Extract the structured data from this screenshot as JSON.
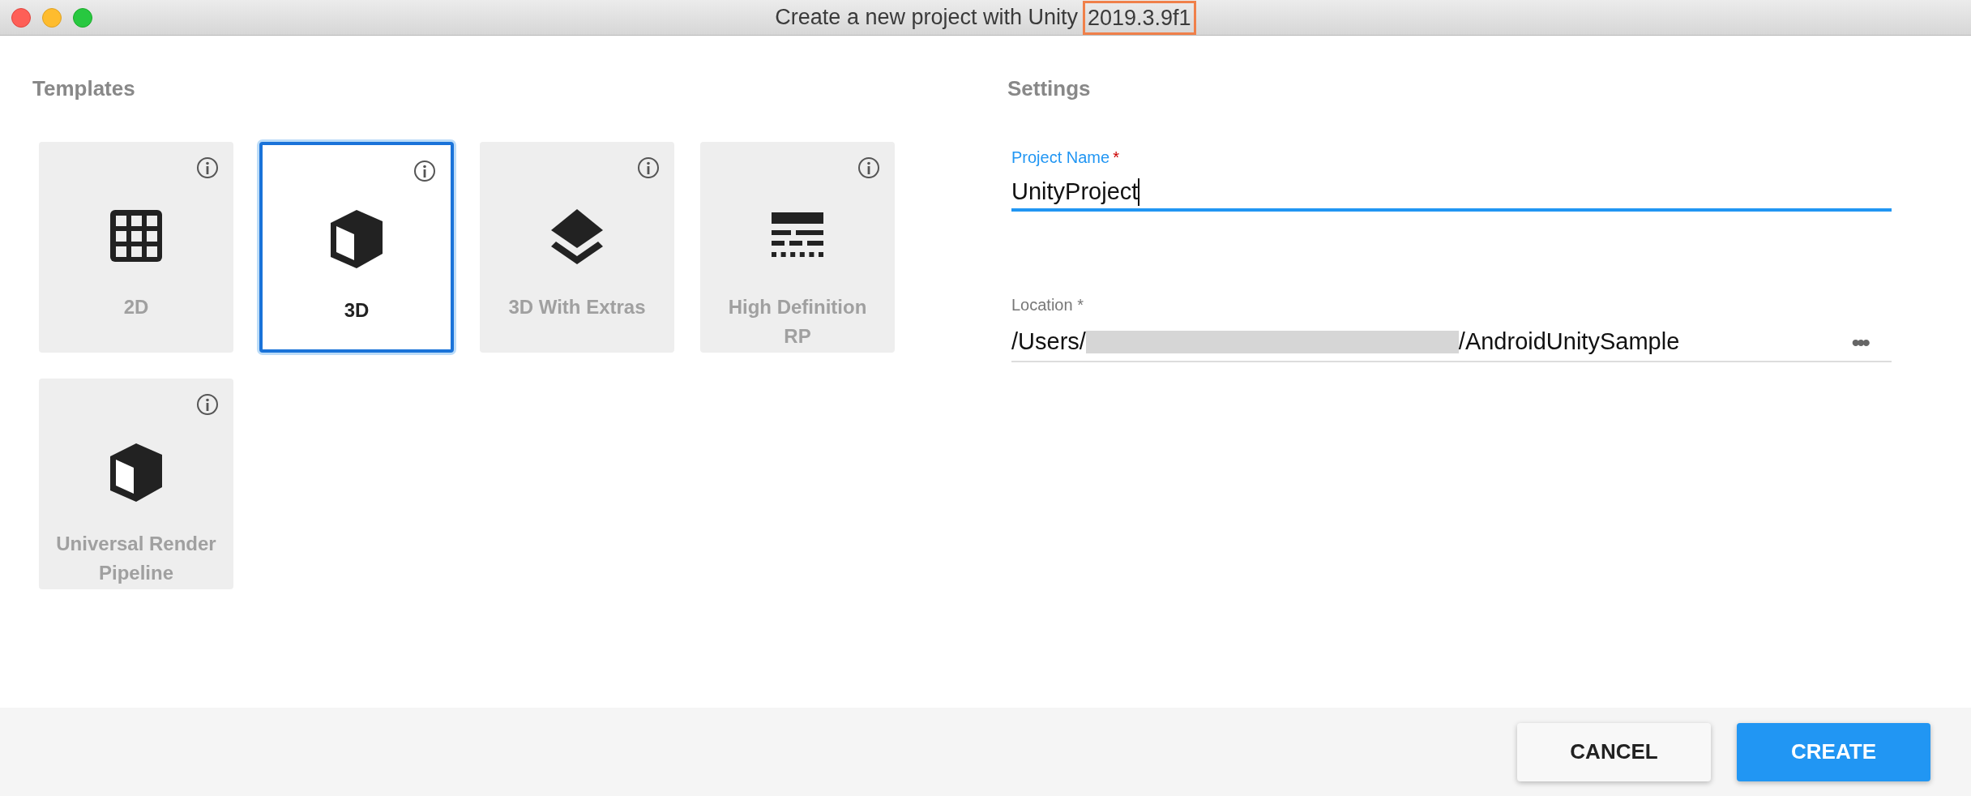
{
  "window": {
    "title": "Create a new project with Unity",
    "version": "2019.3.9f1",
    "version_highlighted": true
  },
  "templates": {
    "heading": "Templates",
    "items": [
      {
        "label": "2D",
        "kind": "grid",
        "selected": false
      },
      {
        "label": "3D",
        "kind": "cube",
        "selected": true
      },
      {
        "label": "3D With Extras",
        "kind": "layers",
        "selected": false
      },
      {
        "label": "High Definition RP",
        "kind": "lines",
        "selected": false
      },
      {
        "label": "Universal Render Pipeline",
        "kind": "cube",
        "selected": false
      }
    ]
  },
  "settings": {
    "heading": "Settings",
    "project_name": {
      "label": "Project Name",
      "required_mark": "*",
      "value": "UnityProject",
      "focused": true
    },
    "location": {
      "label": "Location *",
      "value_start": "/Users/",
      "redacted": true,
      "value_end": "/AndroidUnitySample",
      "browse": "•••"
    }
  },
  "buttons": [
    {
      "label": "CANCEL",
      "kind": "secondary"
    },
    {
      "label": "CREATE",
      "kind": "primary"
    }
  ]
}
